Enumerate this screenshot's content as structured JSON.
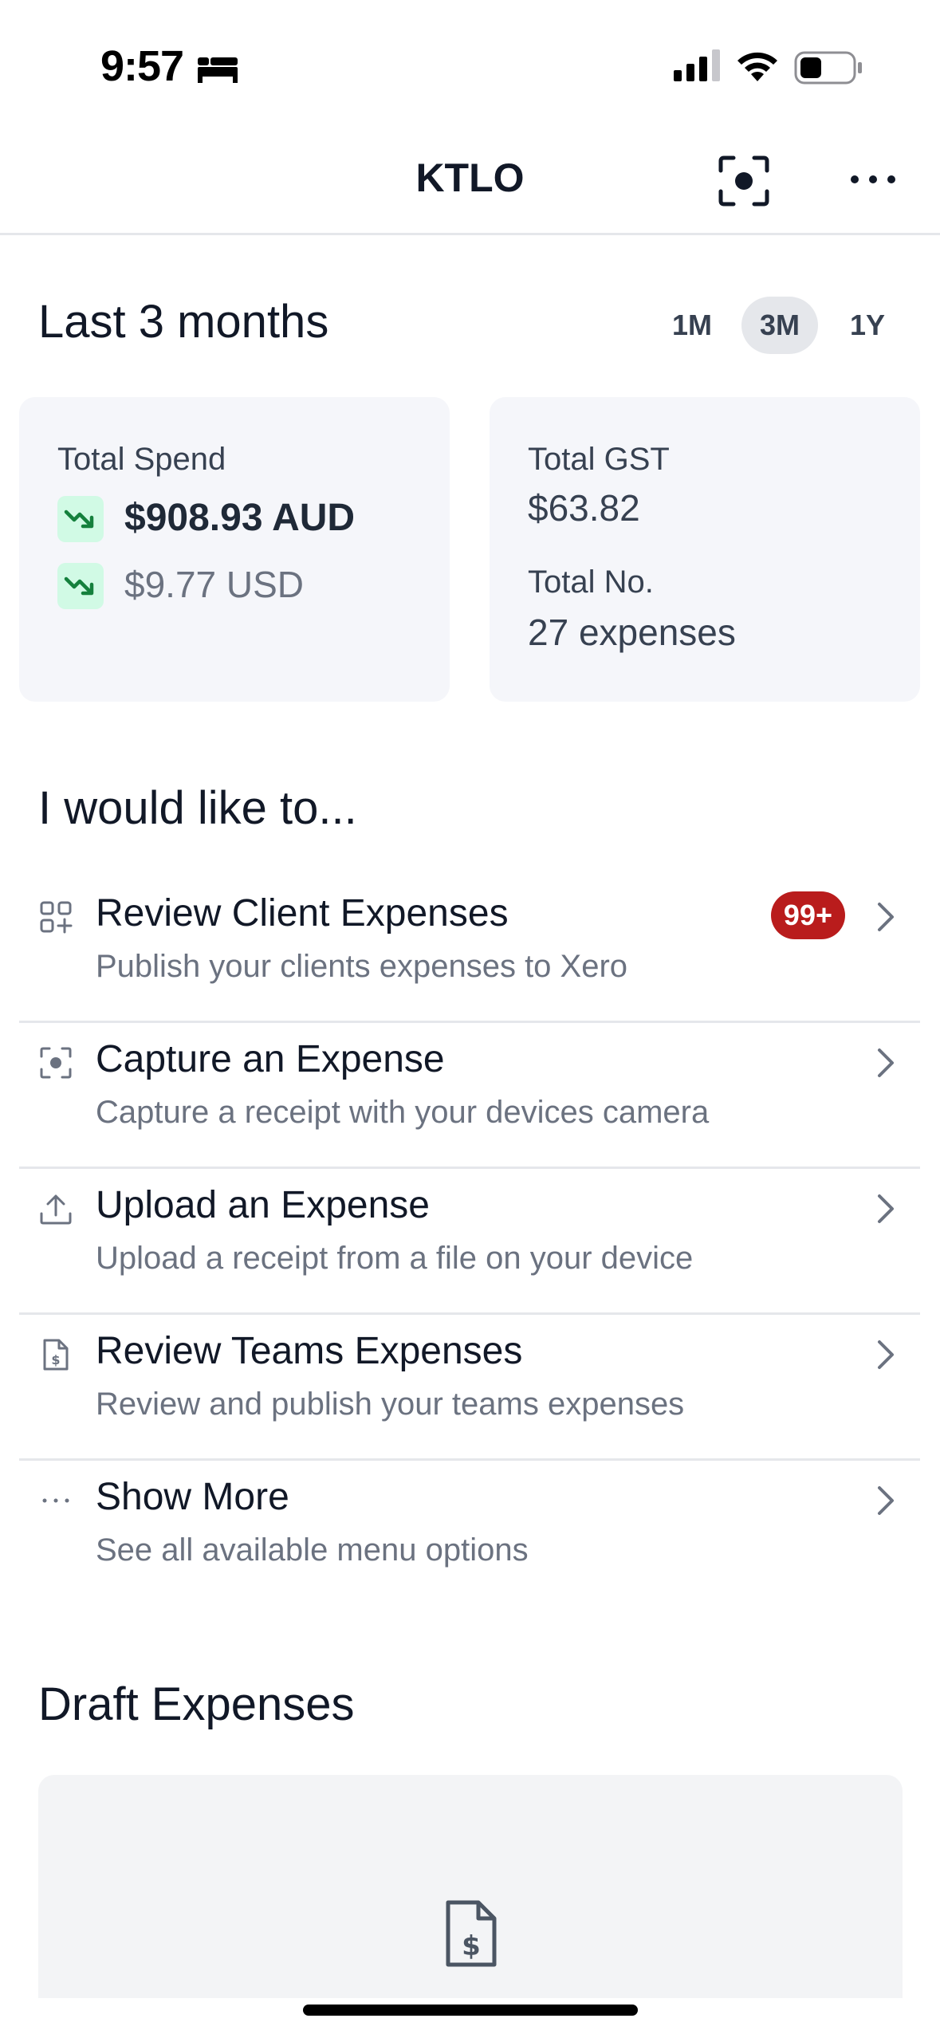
{
  "status_bar": {
    "time": "9:57"
  },
  "nav": {
    "title": "KTLO"
  },
  "period": {
    "title": "Last 3 months",
    "tabs": [
      {
        "label": "1M",
        "active": false
      },
      {
        "label": "3M",
        "active": true
      },
      {
        "label": "1Y",
        "active": false
      }
    ]
  },
  "stats": {
    "spend_label": "Total Spend",
    "spend_aud": "$908.93 AUD",
    "spend_usd": "$9.77 USD",
    "gst_label": "Total GST",
    "gst_value": "$63.82",
    "count_label": "Total No.",
    "count_value": "27 expenses"
  },
  "actions": {
    "title": "I would like to...",
    "items": [
      {
        "title": "Review Client Expenses",
        "subtitle": "Publish your clients expenses to Xero",
        "badge": "99+",
        "icon": "grid-plus-icon"
      },
      {
        "title": "Capture an Expense",
        "subtitle": "Capture a receipt with your devices camera",
        "icon": "scan-icon"
      },
      {
        "title": "Upload an Expense",
        "subtitle": "Upload a receipt from a file on your device",
        "icon": "upload-icon"
      },
      {
        "title": "Review Teams Expenses",
        "subtitle": "Review and publish your teams expenses",
        "icon": "dollar-document-icon"
      },
      {
        "title": "Show More",
        "subtitle": "See all available menu options",
        "icon": "ellipsis-icon"
      }
    ]
  },
  "drafts": {
    "title": "Draft Expenses"
  },
  "colors": {
    "badge": "#b91c1c",
    "trend_bg": "#d1fae5",
    "trend_fg": "#15803d",
    "card_bg": "#f5f6fa"
  }
}
